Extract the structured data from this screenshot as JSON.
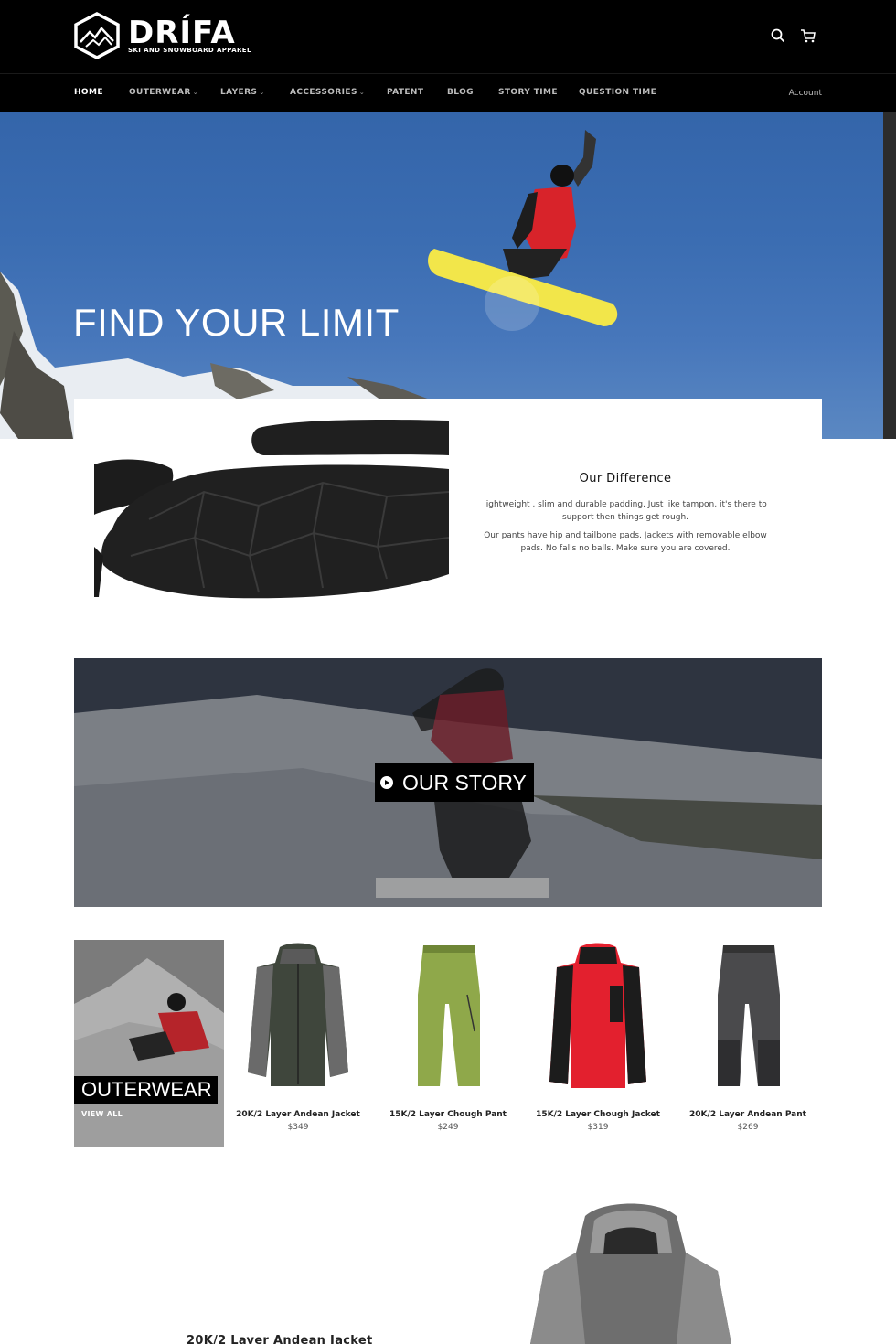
{
  "brand": {
    "name": "DRÍFA",
    "tagline": "SKI AND SNOWBOARD APPAREL"
  },
  "header": {
    "search_icon": "search-icon",
    "cart_icon": "cart-icon"
  },
  "nav": {
    "items": [
      {
        "label": "HOME",
        "active": true,
        "dropdown": false
      },
      {
        "label": "OUTERWEAR",
        "active": false,
        "dropdown": true
      },
      {
        "label": "LAYERS",
        "active": false,
        "dropdown": true
      },
      {
        "label": "ACCESSORIES",
        "active": false,
        "dropdown": true
      },
      {
        "label": "PATENT",
        "active": false,
        "dropdown": false
      },
      {
        "label": "BLOG",
        "active": false,
        "dropdown": false
      },
      {
        "label": "STORY TIME",
        "active": false,
        "dropdown": false
      },
      {
        "label": "QUESTION TIME",
        "active": false,
        "dropdown": false
      }
    ],
    "account_label": "Account",
    "caret": "⌄"
  },
  "hero": {
    "title": "FIND YOUR LIMIT"
  },
  "feature": {
    "title": "Our Difference",
    "paragraph1": "lightweight , slim and durable padding. Just like tampon, it's there to support then things get rough.",
    "paragraph2": "Our pants have hip and tailbone pads. Jackets with removable elbow pads. No falls no balls. Make sure you are covered."
  },
  "story": {
    "button_label": "OUR STORY"
  },
  "collection": {
    "title": "OUTERWEAR",
    "link_label": "VIEW ALL"
  },
  "products": [
    {
      "name": "20K/2 Layer Andean Jacket",
      "price": "$349",
      "color": "#3f463c"
    },
    {
      "name": "15K/2 Layer Chough Pant",
      "price": "$249",
      "color": "#8fa84a"
    },
    {
      "name": "15K/2 Layer Chough Jacket",
      "price": "$319",
      "color": "#e3202e"
    },
    {
      "name": "20K/2 Layer Andean Pant",
      "price": "$269",
      "color": "#4a4a4c"
    }
  ],
  "featured_product": {
    "title": "20K/2 Layer Andean Jacket"
  },
  "colors": {
    "header_bg": "#000000",
    "sky": "#3b6db2",
    "accent_red": "#e3202e"
  }
}
